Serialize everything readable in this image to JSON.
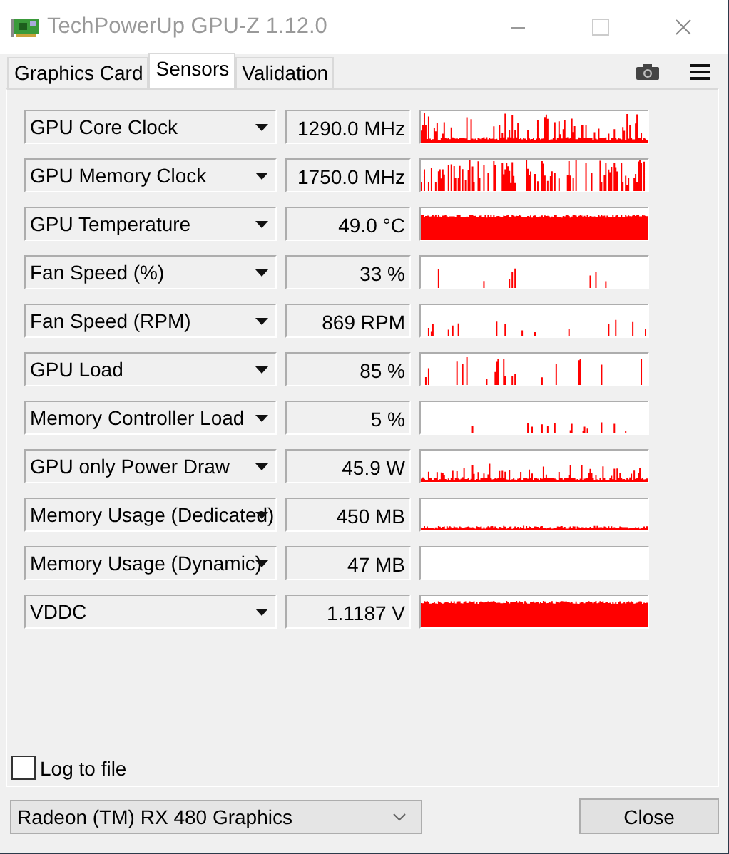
{
  "window": {
    "title": "TechPowerUp GPU-Z 1.12.0"
  },
  "tabs": [
    {
      "label": "Graphics Card",
      "selected": false
    },
    {
      "label": "Sensors",
      "selected": true
    },
    {
      "label": "Validation",
      "selected": false
    }
  ],
  "sensors": [
    {
      "name": "GPU Core Clock",
      "reading": "1290.0 MHz"
    },
    {
      "name": "GPU Memory Clock",
      "reading": "1750.0 MHz"
    },
    {
      "name": "GPU Temperature",
      "reading": "49.0 °C"
    },
    {
      "name": "Fan Speed (%)",
      "reading": "33 %"
    },
    {
      "name": "Fan Speed (RPM)",
      "reading": "869 RPM"
    },
    {
      "name": "GPU Load",
      "reading": "85 %"
    },
    {
      "name": "Memory Controller Load",
      "reading": "5 %"
    },
    {
      "name": "GPU only Power Draw",
      "reading": "45.9 W"
    },
    {
      "name": "Memory Usage (Dedicated)",
      "reading": "450 MB"
    },
    {
      "name": "Memory Usage (Dynamic)",
      "reading": "47 MB"
    },
    {
      "name": "VDDC",
      "reading": "1.1187 V"
    }
  ],
  "log_to_file": {
    "label": "Log to file",
    "checked": false
  },
  "device": {
    "value": "Radeon (TM) RX 480 Graphics"
  },
  "buttons": [
    {
      "label": "Close"
    }
  ]
}
